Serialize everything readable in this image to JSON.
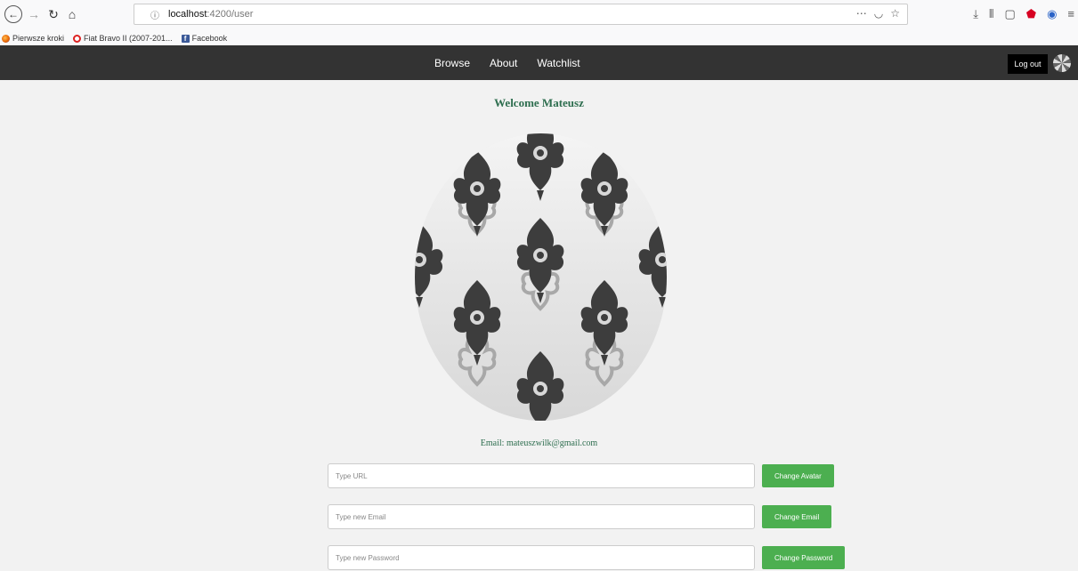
{
  "browser": {
    "url_host": "localhost",
    "url_path": ":4200/user",
    "info_icon": "info-icon",
    "bookmarks": [
      {
        "label": "Pierwsze kroki",
        "icon": "firefox-icon"
      },
      {
        "label": "Fiat Bravo II (2007-201...",
        "icon": "opera-icon"
      },
      {
        "label": "Facebook",
        "icon": "facebook-icon"
      }
    ]
  },
  "navbar": {
    "links": [
      "Browse",
      "About",
      "Watchlist"
    ],
    "logout_label": "Log out",
    "background": "#333333"
  },
  "profile": {
    "welcome": "Welcome Mateusz",
    "email_text": "Email: mateuszwilk@gmail.com"
  },
  "forms": {
    "url_placeholder": "Type URL",
    "avatar_button": "Change Avatar",
    "email_placeholder": "Type new Email",
    "email_button": "Change Email",
    "password_placeholder": "Type new Password",
    "password_button": "Change Password"
  },
  "colors": {
    "accent_green": "#4caf50",
    "heading_green": "#2e6e4f"
  }
}
